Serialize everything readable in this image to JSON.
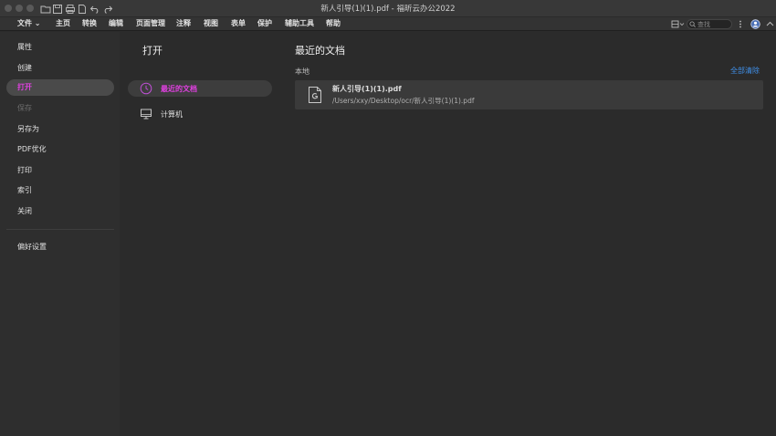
{
  "window": {
    "title": "新人引导(1)(1).pdf - 福昕云办公2022"
  },
  "menubar": {
    "items": [
      {
        "label": "文件 ⌄"
      },
      {
        "label": "主页"
      },
      {
        "label": "转换"
      },
      {
        "label": "编辑"
      },
      {
        "label": "页面管理"
      },
      {
        "label": "注释"
      },
      {
        "label": "视图"
      },
      {
        "label": "表单"
      },
      {
        "label": "保护"
      },
      {
        "label": "辅助工具"
      },
      {
        "label": "帮助"
      }
    ],
    "search_placeholder": "查找"
  },
  "sidebar": {
    "items": [
      {
        "label": "属性"
      },
      {
        "label": "创建"
      },
      {
        "label": "打开"
      },
      {
        "label": "保存"
      },
      {
        "label": "另存为"
      },
      {
        "label": "PDF优化"
      },
      {
        "label": "打印"
      },
      {
        "label": "索引"
      },
      {
        "label": "关闭"
      },
      {
        "label": "偏好设置"
      }
    ]
  },
  "open_panel": {
    "title": "打开",
    "items": [
      {
        "label": "最近的文档",
        "icon": "clock-icon"
      },
      {
        "label": "计算机",
        "icon": "monitor-icon"
      }
    ]
  },
  "recent": {
    "title": "最近的文档",
    "section": "本地",
    "clear_all": "全部清除",
    "files": [
      {
        "name": "新人引导(1)(1).pdf",
        "path": "/Users/xxy/Desktop/ocr/新人引导(1)(1).pdf"
      }
    ]
  },
  "colors": {
    "accent_magenta": "#e040e0",
    "link_blue": "#3f8fe8",
    "sidebar_bg": "#2e2e2e",
    "content_bg": "#2b2b2b"
  }
}
